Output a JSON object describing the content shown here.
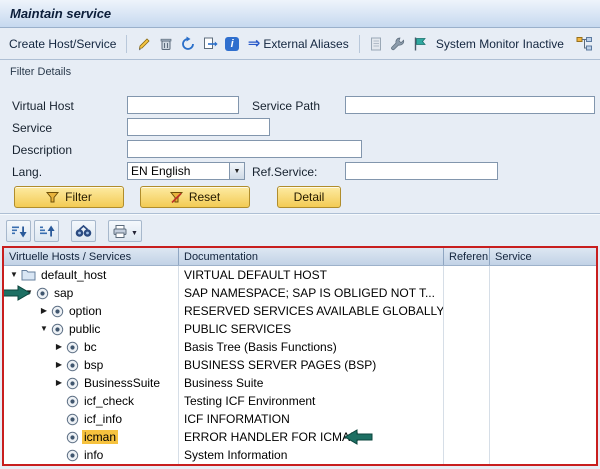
{
  "colors": {
    "frame": "#c81e1e",
    "highlight": "#f6c23e",
    "arrow": "#1d6f63",
    "button": "#f3cb54"
  },
  "titlebar": {
    "title": "Maintain service"
  },
  "toolbar": {
    "create": "Create Host/Service",
    "external_aliases": "External Aliases",
    "system_monitor": "System Monitor Inactive"
  },
  "filter": {
    "heading": "Filter Details",
    "virtual_host_label": "Virtual Host",
    "virtual_host_value": "",
    "service_path_label": "Service Path",
    "service_path_value": "",
    "service_label": "Service",
    "service_value": "",
    "description_label": "Description",
    "description_value": "",
    "lang_label": "Lang.",
    "lang_value": "EN English",
    "ref_service_label": "Ref.Service:",
    "ref_service_value": "",
    "filter_button": "Filter",
    "reset_button": "Reset",
    "detail_button": "Detail"
  },
  "icons": {
    "toolbar": [
      "pencil-icon",
      "trash-icon",
      "refresh-icon",
      "copy-icon",
      "information-icon",
      "external-aliases-arrow-icon",
      "document-icon",
      "wrench-icon",
      "flag-icon",
      "hierarchy-icon"
    ],
    "tree_toolbar": [
      "sort-descending-icon",
      "sort-ascending-icon",
      "binoculars-icon",
      "printer-icon",
      "dropdown-arrow-icon"
    ],
    "buttons": [
      "funnel-icon",
      "funnel-delete-icon"
    ],
    "tree": [
      "folder-icon",
      "service-icon",
      "expander-open-icon",
      "expander-closed-icon",
      "annotation-arrow-icon"
    ]
  },
  "tree": {
    "columns": {
      "hosts": "Virtuelle Hosts / Services",
      "documentation": "Documentation",
      "reference": "Referen",
      "service": "Service"
    },
    "rows": [
      {
        "name": "default_host",
        "doc": "VIRTUAL DEFAULT HOST",
        "level": 0,
        "exp": "open",
        "icon": "folder",
        "hl": false,
        "annotation": null
      },
      {
        "name": "sap",
        "doc": "SAP NAMESPACE; SAP IS OBLIGED NOT T...",
        "level": 1,
        "exp": "open",
        "icon": "service",
        "hl": false,
        "annotation": "arrow-pointing-right-at-row"
      },
      {
        "name": "option",
        "doc": "RESERVED SERVICES AVAILABLE GLOBALLY",
        "level": 2,
        "exp": "closed",
        "icon": "service",
        "hl": false,
        "annotation": null
      },
      {
        "name": "public",
        "doc": "PUBLIC SERVICES",
        "level": 2,
        "exp": "open",
        "icon": "service",
        "hl": false,
        "annotation": null
      },
      {
        "name": "bc",
        "doc": "Basis Tree (Basis Functions)",
        "level": 3,
        "exp": "closed",
        "icon": "service",
        "hl": false,
        "annotation": null
      },
      {
        "name": "bsp",
        "doc": "BUSINESS SERVER PAGES (BSP)",
        "level": 3,
        "exp": "closed",
        "icon": "service",
        "hl": false,
        "annotation": null
      },
      {
        "name": "BusinessSuite",
        "doc": "Business Suite",
        "level": 3,
        "exp": "closed",
        "icon": "service",
        "hl": false,
        "annotation": null
      },
      {
        "name": "icf_check",
        "doc": "Testing ICF Environment",
        "level": 3,
        "exp": "leaf",
        "icon": "service",
        "hl": false,
        "annotation": null
      },
      {
        "name": "icf_info",
        "doc": "ICF INFORMATION",
        "level": 3,
        "exp": "leaf",
        "icon": "service",
        "hl": false,
        "annotation": null
      },
      {
        "name": "icman",
        "doc": "ERROR HANDLER FOR ICMAN",
        "level": 3,
        "exp": "leaf",
        "icon": "service",
        "hl": true,
        "annotation": "arrow-pointing-left-after-doc"
      },
      {
        "name": "info",
        "doc": "System Information",
        "level": 3,
        "exp": "leaf",
        "icon": "service",
        "hl": false,
        "annotation": null
      }
    ]
  }
}
